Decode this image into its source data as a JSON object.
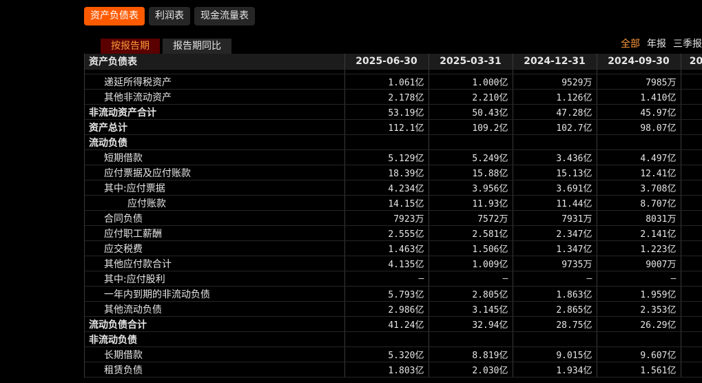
{
  "top_tabs": [
    {
      "label": "资产负债表",
      "active": true
    },
    {
      "label": "利润表",
      "active": false
    },
    {
      "label": "现金流量表",
      "active": false
    }
  ],
  "sub_tabs": [
    {
      "label": "按报告期",
      "active": true
    },
    {
      "label": "报告期同比",
      "active": false
    }
  ],
  "period_filter": [
    {
      "label": "全部",
      "active": true
    },
    {
      "label": "年报",
      "active": false
    },
    {
      "label": "三季报",
      "active": false
    }
  ],
  "table": {
    "header": [
      "资产负债表",
      "2025-06-30",
      "2025-03-31",
      "2024-12-31",
      "2024-09-30",
      "20"
    ],
    "rows": [
      {
        "label": "递延所得税资产",
        "indent": 1,
        "bold": false,
        "values": [
          "1.061亿",
          "1.000亿",
          "9529万",
          "7985万"
        ]
      },
      {
        "label": "其他非流动资产",
        "indent": 1,
        "bold": false,
        "values": [
          "2.178亿",
          "2.210亿",
          "1.126亿",
          "1.410亿"
        ]
      },
      {
        "label": "非流动资产合计",
        "indent": 0,
        "bold": true,
        "values": [
          "53.19亿",
          "50.43亿",
          "47.28亿",
          "45.97亿"
        ]
      },
      {
        "label": "资产总计",
        "indent": 0,
        "bold": true,
        "values": [
          "112.1亿",
          "109.2亿",
          "102.7亿",
          "98.07亿"
        ]
      },
      {
        "label": "流动负债",
        "indent": 0,
        "bold": true,
        "values": [
          "",
          "",
          "",
          ""
        ]
      },
      {
        "label": "短期借款",
        "indent": 1,
        "bold": false,
        "values": [
          "5.129亿",
          "5.249亿",
          "3.436亿",
          "4.497亿"
        ]
      },
      {
        "label": "应付票据及应付账款",
        "indent": 1,
        "bold": false,
        "values": [
          "18.39亿",
          "15.88亿",
          "15.13亿",
          "12.41亿"
        ]
      },
      {
        "label": "其中:应付票据",
        "indent": 1,
        "bold": false,
        "values": [
          "4.234亿",
          "3.956亿",
          "3.691亿",
          "3.708亿"
        ]
      },
      {
        "label": "应付账款",
        "indent": 2,
        "bold": false,
        "values": [
          "14.15亿",
          "11.93亿",
          "11.44亿",
          "8.707亿"
        ]
      },
      {
        "label": "合同负债",
        "indent": 1,
        "bold": false,
        "values": [
          "7923万",
          "7572万",
          "7931万",
          "8031万"
        ]
      },
      {
        "label": "应付职工薪酬",
        "indent": 1,
        "bold": false,
        "values": [
          "2.555亿",
          "2.581亿",
          "2.347亿",
          "2.141亿"
        ]
      },
      {
        "label": "应交税费",
        "indent": 1,
        "bold": false,
        "values": [
          "1.463亿",
          "1.506亿",
          "1.347亿",
          "1.223亿"
        ]
      },
      {
        "label": "其他应付款合计",
        "indent": 1,
        "bold": false,
        "values": [
          "4.135亿",
          "1.009亿",
          "9735万",
          "9007万"
        ]
      },
      {
        "label": "其中:应付股利",
        "indent": 1,
        "bold": false,
        "values": [
          "—",
          "—",
          "—",
          "—"
        ]
      },
      {
        "label": "一年内到期的非流动负债",
        "indent": 1,
        "bold": false,
        "values": [
          "5.793亿",
          "2.805亿",
          "1.863亿",
          "1.959亿"
        ]
      },
      {
        "label": "其他流动负债",
        "indent": 1,
        "bold": false,
        "values": [
          "2.986亿",
          "3.145亿",
          "2.865亿",
          "2.353亿"
        ]
      },
      {
        "label": "流动负债合计",
        "indent": 0,
        "bold": true,
        "values": [
          "41.24亿",
          "32.94亿",
          "28.75亿",
          "26.29亿"
        ]
      },
      {
        "label": "非流动负债",
        "indent": 0,
        "bold": true,
        "values": [
          "",
          "",
          "",
          ""
        ]
      },
      {
        "label": "长期借款",
        "indent": 1,
        "bold": false,
        "values": [
          "5.320亿",
          "8.819亿",
          "9.015亿",
          "9.607亿"
        ]
      },
      {
        "label": "租赁负债",
        "indent": 1,
        "bold": false,
        "values": [
          "1.803亿",
          "2.030亿",
          "1.934亿",
          "1.561亿"
        ]
      }
    ]
  },
  "colors": {
    "accent": "#ff5a00",
    "sub_active_bg": "#5a0000",
    "highlight_text": "#ff9a3a"
  }
}
